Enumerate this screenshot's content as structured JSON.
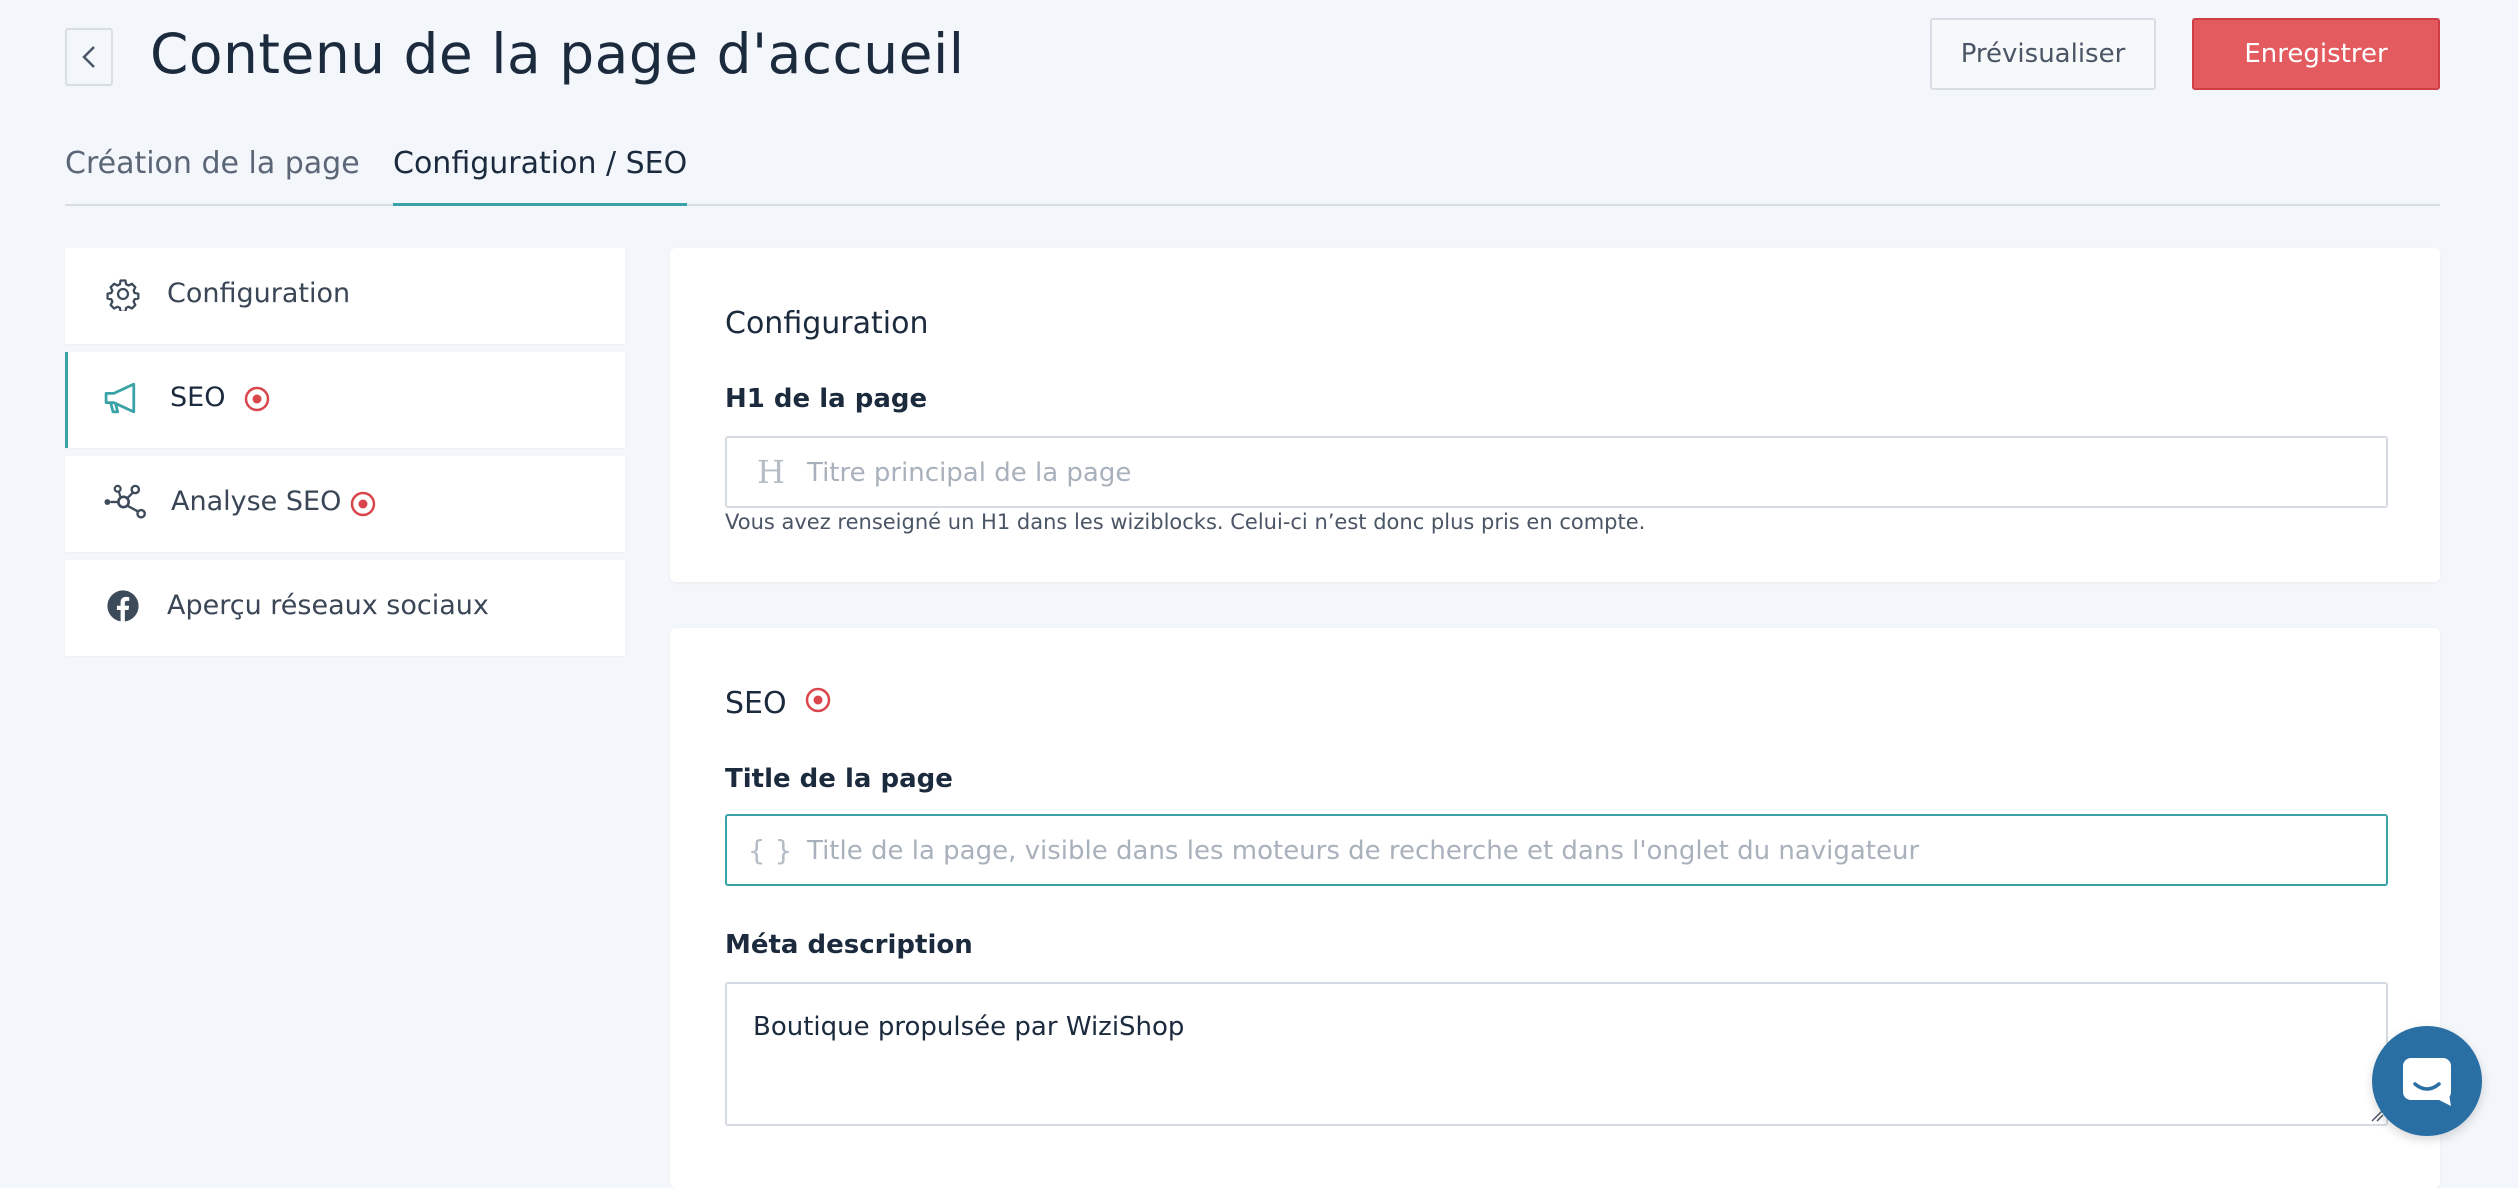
{
  "header": {
    "title": "Contenu de la page d'accueil",
    "preview_label": "Prévisualiser",
    "save_label": "Enregistrer"
  },
  "tabs": [
    {
      "label": "Création de la page",
      "active": false
    },
    {
      "label": "Configuration / SEO",
      "active": true
    }
  ],
  "sidebar": {
    "items": [
      {
        "label": "Configuration",
        "icon": "gear-icon",
        "active": false,
        "badge": false
      },
      {
        "label": "SEO",
        "icon": "megaphone-icon",
        "active": true,
        "badge": true
      },
      {
        "label": "Analyse SEO",
        "icon": "network-icon",
        "active": false,
        "badge": true
      },
      {
        "label": "Aperçu réseaux sociaux",
        "icon": "facebook-icon",
        "active": false,
        "badge": false
      }
    ]
  },
  "config_card": {
    "title": "Configuration",
    "h1_label": "H1 de la page",
    "h1_placeholder": "Titre principal de la page",
    "h1_prefix": "H",
    "h1_help": "Vous avez renseigné un H1 dans les wiziblocks. Celui-ci n’est donc plus pris en compte."
  },
  "seo_card": {
    "title": "SEO",
    "title_label": "Title de la page",
    "title_prefix": "{ }",
    "title_placeholder": "Title de la page, visible dans les moteurs de recherche et dans l'onglet du navigateur",
    "meta_label": "Méta description",
    "meta_value": "Boutique propulsée par WiziShop"
  },
  "colors": {
    "accent": "#3aa3a7",
    "primary_button": "#e35a5f",
    "badge": "#d9474d",
    "chat": "#2a6fa3"
  }
}
